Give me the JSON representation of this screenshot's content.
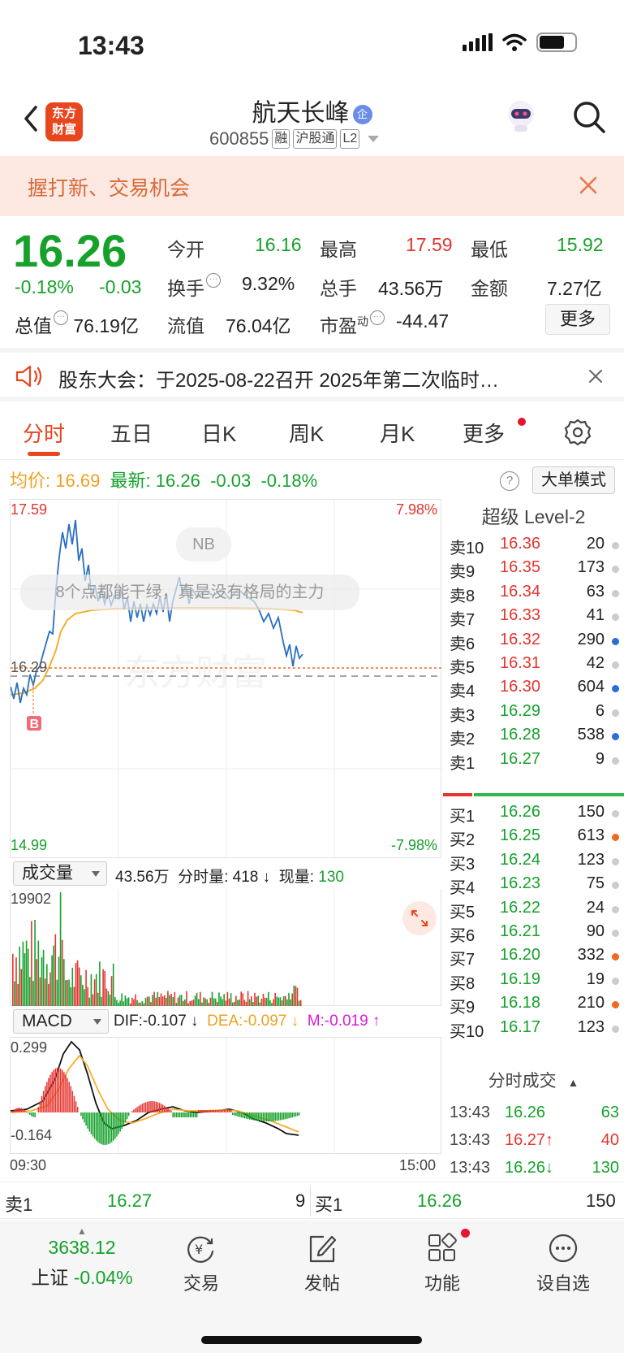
{
  "status_bar": {
    "time": "13:43"
  },
  "header": {
    "logo_line1": "东方",
    "logo_line2": "财富",
    "stock_name": "航天长峰",
    "qi_badge": "企",
    "code": "600855",
    "tags": [
      "融",
      "沪股通",
      "L2"
    ]
  },
  "banner": {
    "text": "握打新、交易机会"
  },
  "quote": {
    "price": "16.26",
    "change_pct": "-0.18%",
    "change": "-0.03",
    "total_value_label": "总值",
    "total_value": "76.19亿",
    "open_label": "今开",
    "open": "16.16",
    "high_label": "最高",
    "high": "17.59",
    "low_label": "最低",
    "low": "15.92",
    "turnover_label": "换手",
    "turnover": "9.32%",
    "volume_label": "总手",
    "volume": "43.56万",
    "amount_label": "金额",
    "amount": "7.27亿",
    "float_label": "流值",
    "float_value": "76.04亿",
    "pe_label": "市盈",
    "pe_sup": "动",
    "pe": "-44.47",
    "more": "更多"
  },
  "notice": {
    "text": "股东大会：于2025-08-22召开 2025年第二次临时…"
  },
  "tabs": [
    "分时",
    "五日",
    "日K",
    "周K",
    "月K",
    "更多"
  ],
  "avg_line": {
    "avg_label": "均价:",
    "avg": "16.69",
    "latest_label": "最新:",
    "latest": "16.26",
    "chg": "-0.03",
    "pct": "-0.18%",
    "help": "?",
    "big_mode": "大单模式"
  },
  "main_chart": {
    "top_price": "17.59",
    "top_pct": "7.98%",
    "bottom_price": "14.99",
    "bottom_pct": "-7.98%",
    "mid_price": "16.29",
    "nb": "NB",
    "comment": "8个点都能干绿，真是没有格局的主力",
    "watermark": "东方财富",
    "b_marker": "B"
  },
  "volume": {
    "selector": "成交量",
    "total": "43.56万",
    "per_label": "分时量:",
    "per_value": "418",
    "now_label": "现量:",
    "now_value": "130",
    "max": "19902"
  },
  "macd": {
    "selector": "MACD",
    "dif": "DIF:-0.107",
    "dea": "DEA:-0.097",
    "m": "M:-0.019",
    "top": "0.299",
    "bottom": "-0.164",
    "start_time": "09:30",
    "end_time": "15:00"
  },
  "level2": {
    "title": "超级 Level-2",
    "asks": [
      {
        "label": "卖10",
        "price": "16.36",
        "qty": "20",
        "dot": "#cccccc"
      },
      {
        "label": "卖9",
        "price": "16.35",
        "qty": "173",
        "dot": "#cccccc"
      },
      {
        "label": "卖8",
        "price": "16.34",
        "qty": "63",
        "dot": "#cccccc"
      },
      {
        "label": "卖7",
        "price": "16.33",
        "qty": "41",
        "dot": "#cccccc"
      },
      {
        "label": "卖6",
        "price": "16.32",
        "qty": "290",
        "dot": "#2a6fd6"
      },
      {
        "label": "卖5",
        "price": "16.31",
        "qty": "42",
        "dot": "#cccccc"
      },
      {
        "label": "卖4",
        "price": "16.30",
        "qty": "604",
        "dot": "#2a6fd6"
      },
      {
        "label": "卖3",
        "price": "16.29",
        "qty": "6",
        "dot": "#cccccc"
      },
      {
        "label": "卖2",
        "price": "16.28",
        "qty": "538",
        "dot": "#2a6fd6"
      },
      {
        "label": "卖1",
        "price": "16.27",
        "qty": "9",
        "dot": "#cccccc"
      }
    ],
    "bids": [
      {
        "label": "买1",
        "price": "16.26",
        "qty": "150",
        "dot": "#cccccc"
      },
      {
        "label": "买2",
        "price": "16.25",
        "qty": "613",
        "dot": "#f06a1a"
      },
      {
        "label": "买3",
        "price": "16.24",
        "qty": "123",
        "dot": "#cccccc"
      },
      {
        "label": "买4",
        "price": "16.23",
        "qty": "75",
        "dot": "#cccccc"
      },
      {
        "label": "买5",
        "price": "16.22",
        "qty": "24",
        "dot": "#cccccc"
      },
      {
        "label": "买6",
        "price": "16.21",
        "qty": "90",
        "dot": "#cccccc"
      },
      {
        "label": "买7",
        "price": "16.20",
        "qty": "332",
        "dot": "#f06a1a"
      },
      {
        "label": "买8",
        "price": "16.19",
        "qty": "19",
        "dot": "#cccccc"
      },
      {
        "label": "买9",
        "price": "16.18",
        "qty": "210",
        "dot": "#f06a1a"
      },
      {
        "label": "买10",
        "price": "16.17",
        "qty": "123",
        "dot": "#cccccc"
      }
    ],
    "ticks_title": "分时成交",
    "ticks": [
      {
        "time": "13:43",
        "price": "16.26",
        "qty": "63",
        "color": "green",
        "qty_color": "green"
      },
      {
        "time": "13:43",
        "price": "16.27↑",
        "qty": "40",
        "color": "red",
        "qty_color": "red"
      },
      {
        "time": "13:43",
        "price": "16.26↓",
        "qty": "130",
        "color": "green",
        "qty_color": "green"
      }
    ]
  },
  "bidask": {
    "ask_label": "卖1",
    "ask_price": "16.27",
    "ask_qty": "9",
    "bid_label": "买1",
    "bid_price": "16.26",
    "bid_qty": "150"
  },
  "bottom_nav": {
    "index_value": "3638.12",
    "index_name": "上证",
    "index_pct": "-0.04%",
    "items": [
      "交易",
      "发帖",
      "功能",
      "设自选"
    ]
  },
  "colors": {
    "up": "#e5342f",
    "down": "#16a12b",
    "brand": "#e9461e",
    "price_line": "#2a6fbf",
    "avg_line": "#f5b02a"
  },
  "chart_data": [
    {
      "type": "line",
      "title": "",
      "ylim": [
        14.99,
        17.59
      ],
      "x_range": [
        "09:30",
        "15:00"
      ],
      "series": [
        {
          "values": [
            16.1,
            16.05,
            16.2,
            16.25,
            16.6,
            17.0,
            17.4,
            17.45,
            17.3,
            17.1,
            16.9,
            16.8,
            16.85,
            16.7,
            16.75,
            16.8,
            16.85,
            16.75,
            16.9,
            16.8,
            16.7,
            16.6,
            16.55,
            16.4,
            16.3,
            16.26
          ]
        },
        {
          "values": [
            16.1,
            16.2,
            16.45,
            16.6,
            16.75,
            16.8,
            16.82,
            16.83,
            16.83,
            16.83,
            16.83,
            16.83,
            16.83,
            16.82,
            16.82,
            16.82,
            16.82,
            16.82,
            16.82,
            16.82,
            16.81,
            16.8
          ]
        }
      ]
    },
    {
      "type": "bar",
      "title": "",
      "ylim": [
        0,
        19902
      ],
      "series": [
        {
          "values": [
            19902
          ]
        }
      ]
    },
    {
      "type": "bar",
      "title": "",
      "ylim": [
        -0.164,
        0.299
      ],
      "series": [
        {
          "values": [
            -0.107,
            -0.097,
            -0.019
          ]
        }
      ]
    }
  ]
}
